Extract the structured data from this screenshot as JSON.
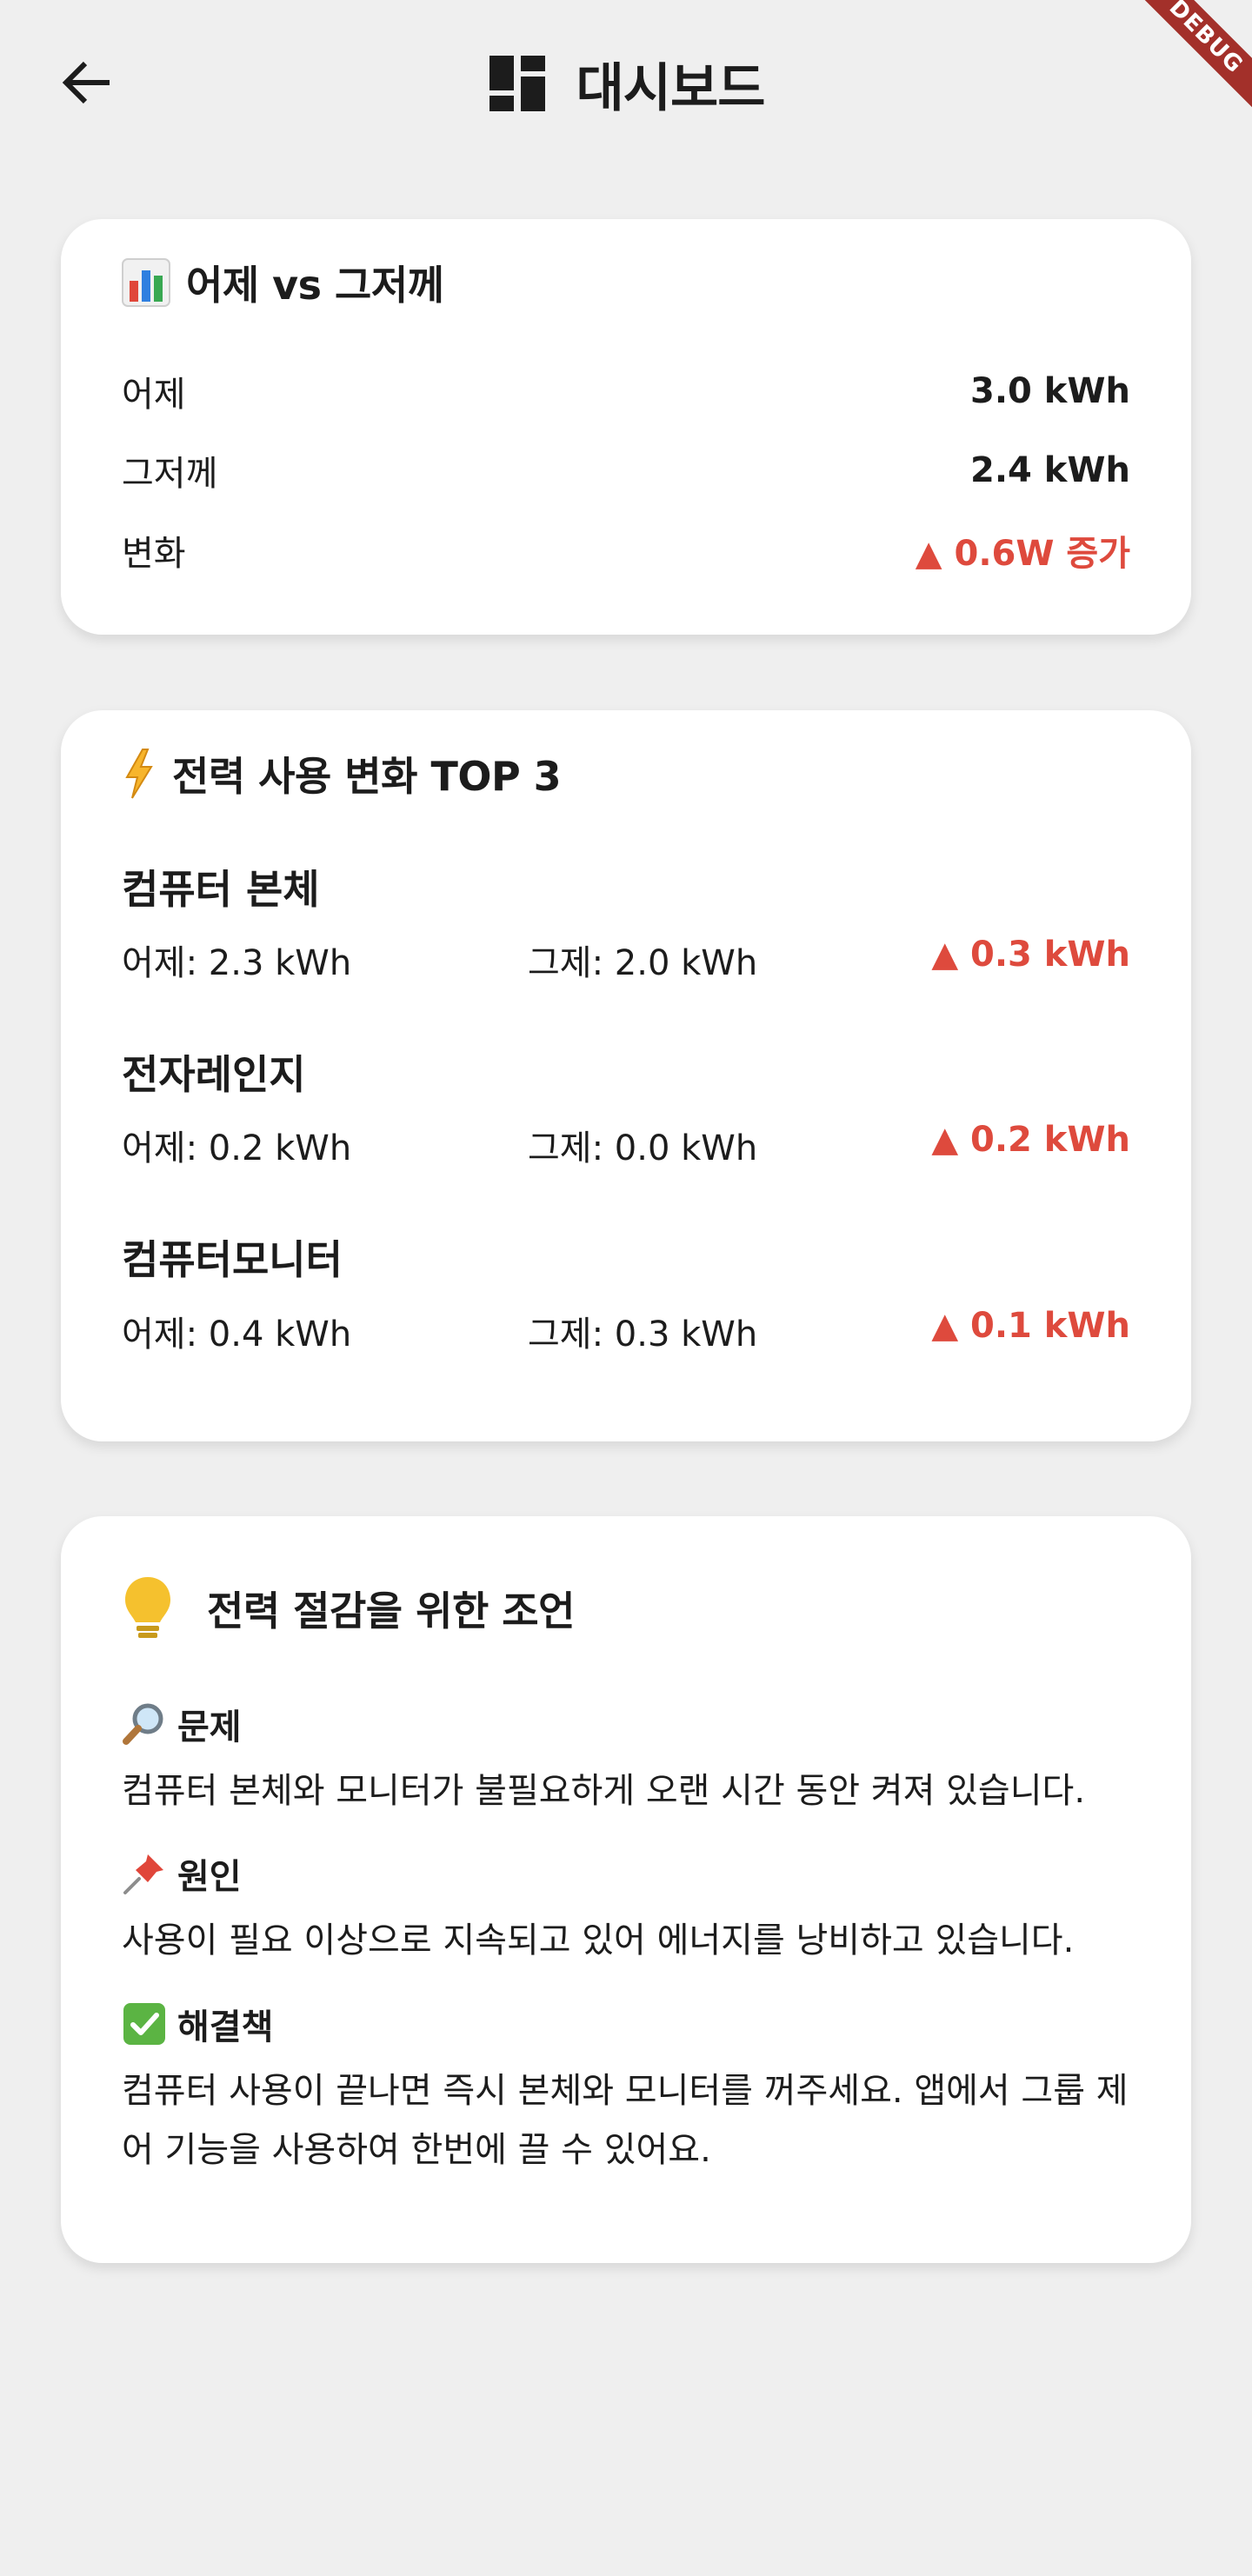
{
  "appbar": {
    "title": "대시보드",
    "back_icon": "arrow-left-icon",
    "title_icon": "dashboard-icon",
    "debug_label": "DEBUG"
  },
  "comparison": {
    "icon": "bar-chart-icon",
    "title": "어제 vs 그저께",
    "rows": [
      {
        "label": "어제",
        "value": "3.0 kWh"
      },
      {
        "label": "그저께",
        "value": "2.4 kWh"
      },
      {
        "label": "변화",
        "value": "▲ 0.6W 증가"
      }
    ]
  },
  "top3": {
    "icon": "lightning-icon",
    "title": "전력 사용 변화 TOP 3",
    "items": [
      {
        "name": "컴퓨터 본체",
        "yesterday": "어제: 2.3 kWh",
        "before": "그제: 2.0 kWh",
        "delta": "▲ 0.3 kWh"
      },
      {
        "name": "전자레인지",
        "yesterday": "어제: 0.2 kWh",
        "before": "그제: 0.0 kWh",
        "delta": "▲ 0.2 kWh"
      },
      {
        "name": "컴퓨터모니터",
        "yesterday": "어제: 0.4 kWh",
        "before": "그제: 0.3 kWh",
        "delta": "▲ 0.1 kWh"
      }
    ]
  },
  "advice": {
    "icon": "lightbulb-icon",
    "title": "전력 절감을 위한 조언",
    "sections": [
      {
        "icon": "magnifier-icon",
        "heading": "문제",
        "text": "컴퓨터 본체와 모니터가 불필요하게 오랜 시간 동안 켜져 있습니다."
      },
      {
        "icon": "pushpin-icon",
        "heading": "원인",
        "text": "사용이 필요 이상으로 지속되고 있어 에너지를 낭비하고 있습니다."
      },
      {
        "icon": "checkmark-icon",
        "heading": "해결책",
        "text": "컴퓨터 사용이 끝나면 즉시 본체와 모니터를 꺼주세요. 앱에서 그룹 제어 기능을 사용하여 한번에 끌 수 있어요."
      }
    ]
  },
  "colors": {
    "background": "#efefef",
    "card": "#ffffff",
    "increase_red": "#de4a3d",
    "text": "#1c1c1c",
    "bulb_yellow": "#f5c12e",
    "check_green": "#5bb443"
  }
}
